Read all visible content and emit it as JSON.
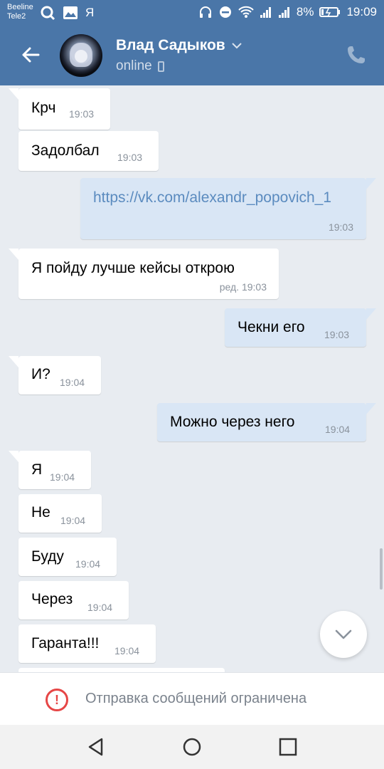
{
  "status_bar": {
    "carrier1": "Beeline",
    "carrier2": "Tele2",
    "battery": "8%",
    "time": "19:09",
    "left_icons": [
      "q-app-icon",
      "gallery-icon",
      "yandex-icon"
    ],
    "right_icons": [
      "headphones-icon",
      "dnd-icon",
      "wifi-icon",
      "signal-icon",
      "signal-icon",
      "battery-icon"
    ]
  },
  "header": {
    "name": "Влад Садыков",
    "status": "online",
    "colors": {
      "bar": "#4a76a8"
    }
  },
  "messages": [
    {
      "dir": "in",
      "text": "Крч",
      "time": "19:03"
    },
    {
      "dir": "in",
      "text": "Задолбал",
      "time": "19:03"
    },
    {
      "dir": "out",
      "text": "https://vk.com/alexandr_popovich_1",
      "time": "19:03",
      "is_link": true
    },
    {
      "dir": "in",
      "text": "Я пойду лучше кейсы открою",
      "time": "ред. 19:03"
    },
    {
      "dir": "out",
      "text": "Чекни его",
      "time": "19:03"
    },
    {
      "dir": "in",
      "text": "И?",
      "time": "19:04"
    },
    {
      "dir": "out",
      "text": "Можно через него",
      "time": "19:04"
    },
    {
      "dir": "in",
      "text": "Я",
      "time": "19:04"
    },
    {
      "dir": "in",
      "text": "Не",
      "time": "19:04"
    },
    {
      "dir": "in",
      "text": "Буду",
      "time": "19:04"
    },
    {
      "dir": "in",
      "text": "Через",
      "time": "19:04"
    },
    {
      "dir": "in",
      "text": "Гаранта!!!",
      "time": "19:04"
    }
  ],
  "restriction": {
    "text": "Отправка сообщений ограничена",
    "icon": "exclamation-circle-icon",
    "color": "#e64646"
  },
  "nav": {
    "icons": [
      "back-triangle-icon",
      "home-circle-icon",
      "recents-square-icon"
    ]
  }
}
